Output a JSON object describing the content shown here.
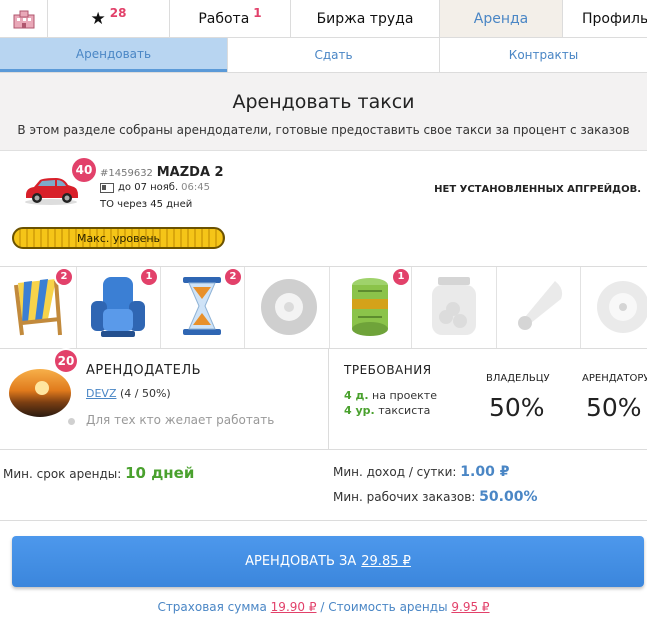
{
  "topnav": {
    "home_icon": "building-icon",
    "favorites_count": "28",
    "work_label": "Работа",
    "work_count": "1",
    "exchange_label": "Биржа труда",
    "rent_label": "Аренда",
    "profile_label": "Профиль"
  },
  "subtabs": [
    "Арендовать",
    "Сдать",
    "Контракты"
  ],
  "header": {
    "title": "Арендовать такси",
    "description": "В этом разделе собраны арендодатели, готовые предоставить свое такси за процент с заказов"
  },
  "car": {
    "level": "40",
    "id": "#1459632",
    "model": "MAZDA 2",
    "registration": "до 07 нояб.",
    "registration_time": "06:45",
    "maintenance": "ТО через 45 дней",
    "upgrades": "НЕТ УСТАНОВЛЕННЫХ АПГРЕЙДОВ.",
    "level_bar": "Макс. уровень",
    "level_fraction": 1.0
  },
  "perks": [
    {
      "icon": "beach-chair-icon",
      "count": "2"
    },
    {
      "icon": "armchair-icon",
      "count": "1"
    },
    {
      "icon": "hourglass-icon",
      "count": "2"
    },
    {
      "icon": "tire-icon",
      "count": ""
    },
    {
      "icon": "money-roll-icon",
      "count": "1"
    },
    {
      "icon": "coin-jar-icon",
      "count": ""
    },
    {
      "icon": "horn-icon",
      "count": ""
    },
    {
      "icon": "disc-icon",
      "count": ""
    }
  ],
  "landlord": {
    "level": "20",
    "title": "АРЕНДОДАТЕЛЬ",
    "username": "DEVZ",
    "stats": "(4 / 50%)",
    "note": "Для тех кто желает работать",
    "requirements_title": "ТРЕБОВАНИЯ",
    "req_days": "4 д.",
    "req_days_text": "на проекте",
    "req_level": "4 ур.",
    "req_level_text": "таксиста",
    "owner_label": "ВЛАДЕЛЬЦУ",
    "owner_share": "50%",
    "tenant_label": "АРЕНДАТОРУ",
    "tenant_share": "50%"
  },
  "terms": {
    "min_term_label": "Мин. срок аренды:",
    "min_term_value": "10 дней",
    "min_income_label": "Мин. доход / сутки:",
    "min_income_value": "1.00 ₽",
    "min_orders_label": "Мин. рабочих заказов:",
    "min_orders_value": "50.00%"
  },
  "button": {
    "label": "АРЕНДОВАТЬ ЗА",
    "price": "29.85 ₽"
  },
  "footer": {
    "insurance_label": "Страховая сумма",
    "insurance_value": "19.90 ₽",
    "separator": "/",
    "cost_label": "Стоимость аренды",
    "cost_value": "9.95 ₽"
  }
}
